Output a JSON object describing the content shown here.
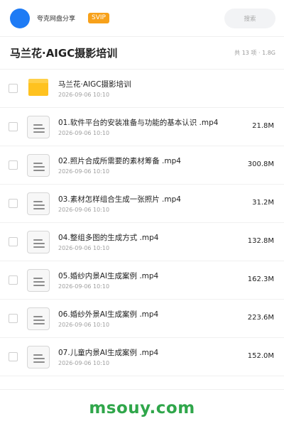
{
  "header": {
    "username": "夸克网盘分享",
    "badge": "SVIP",
    "search_placeholder": "搜索",
    "avatar_color": "#1e7bf5",
    "badge_color": "#f7a11a"
  },
  "title": {
    "text": "马兰花·AIGC摄影培训",
    "meta": "共 13 项 · 1.8G"
  },
  "items": [
    {
      "type": "folder",
      "name": "马兰花·AIGC摄影培训",
      "date": "2026-09-06 10:10",
      "size": ""
    },
    {
      "type": "file",
      "name": "01.软件平台的安装准备与功能的基本认识 .mp4",
      "date": "2026-09-06 10:10",
      "size": "21.8M"
    },
    {
      "type": "file",
      "name": "02.照片合成所需要的素材筹备 .mp4",
      "date": "2026-09-06 10:10",
      "size": "300.8M"
    },
    {
      "type": "file",
      "name": "03.素材怎样组合生成一张照片 .mp4",
      "date": "2026-09-06 10:10",
      "size": "31.2M"
    },
    {
      "type": "file",
      "name": "04.整组多图的生成方式 .mp4",
      "date": "2026-09-06 10:10",
      "size": "132.8M"
    },
    {
      "type": "file",
      "name": "05.婚纱内景AI生成案例 .mp4",
      "date": "2026-09-06 10:10",
      "size": "162.3M"
    },
    {
      "type": "file",
      "name": "06.婚纱外景AI生成案例 .mp4",
      "date": "2026-09-06 10:10",
      "size": "223.6M"
    },
    {
      "type": "file",
      "name": "07.儿童内景AI生成案例 .mp4",
      "date": "2026-09-06 10:10",
      "size": "152.0M"
    }
  ],
  "footer": {
    "watermark": "msouy.com",
    "watermark_color": "#2fa64a"
  }
}
